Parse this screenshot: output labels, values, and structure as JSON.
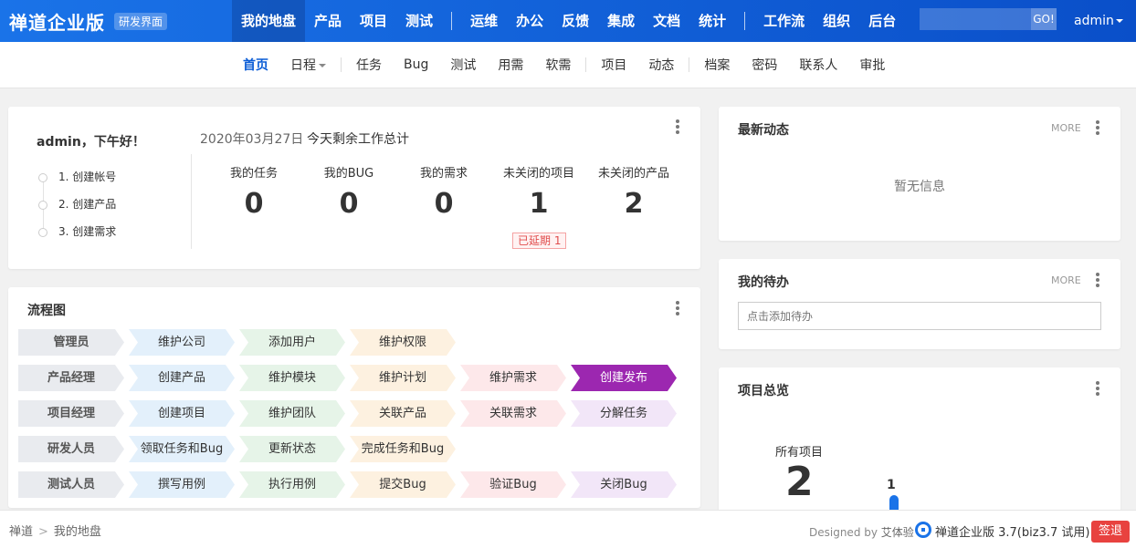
{
  "header": {
    "brand": "禅道企业版",
    "badge": "研发界面",
    "nav": [
      "我的地盘",
      "产品",
      "项目",
      "测试",
      "运维",
      "办公",
      "反馈",
      "集成",
      "文档",
      "统计",
      "工作流",
      "组织",
      "后台"
    ],
    "search_button": "GO!",
    "user": "admin"
  },
  "subnav": {
    "items": [
      "首页",
      "日程",
      "任务",
      "Bug",
      "测试",
      "用需",
      "软需",
      "项目",
      "动态",
      "档案",
      "密码",
      "联系人",
      "审批"
    ]
  },
  "welcome": {
    "greeting": "admin，下午好！",
    "steps": [
      "1. 创建帐号",
      "2. 创建产品",
      "3. 创建需求"
    ],
    "date": "2020年03月27日",
    "summary_title": "今天剩余工作总计",
    "stats": [
      {
        "label": "我的任务",
        "value": "0"
      },
      {
        "label": "我的BUG",
        "value": "0"
      },
      {
        "label": "我的需求",
        "value": "0"
      },
      {
        "label": "未关闭的项目",
        "value": "1"
      },
      {
        "label": "未关闭的产品",
        "value": "2"
      }
    ],
    "delay_badge": "已延期 1"
  },
  "flow": {
    "title": "流程图",
    "rows": [
      [
        "管理员",
        "维护公司",
        "添加用户",
        "维护权限"
      ],
      [
        "产品经理",
        "创建产品",
        "维护模块",
        "维护计划",
        "维护需求",
        "创建发布"
      ],
      [
        "项目经理",
        "创建项目",
        "维护团队",
        "关联产品",
        "关联需求",
        "分解任务"
      ],
      [
        "研发人员",
        "领取任务和Bug",
        "更新状态",
        "完成任务和Bug"
      ],
      [
        "测试人员",
        "撰写用例",
        "执行用例",
        "提交Bug",
        "验证Bug",
        "关闭Bug"
      ]
    ],
    "colors": [
      "#e9ebef",
      "#e3f0fb",
      "#e6f4e8",
      "#fdf1e0",
      "#fde8ea",
      "#f2e6f8"
    ],
    "highlight_color": "#9c27b0"
  },
  "news": {
    "title": "最新动态",
    "more": "MORE",
    "empty": "暂无信息"
  },
  "todo": {
    "title": "我的待办",
    "more": "MORE",
    "placeholder": "点击添加待办"
  },
  "overview": {
    "title": "项目总览",
    "all_label": "所有项目",
    "all_value": "2",
    "bar_value": "1"
  },
  "footer": {
    "crumb": [
      "禅道",
      "我的地盘"
    ],
    "designed_by": "Designed by",
    "designer": "艾体验",
    "version": "禅道企业版 3.7(biz3.7 试用)",
    "logout": "签退"
  }
}
